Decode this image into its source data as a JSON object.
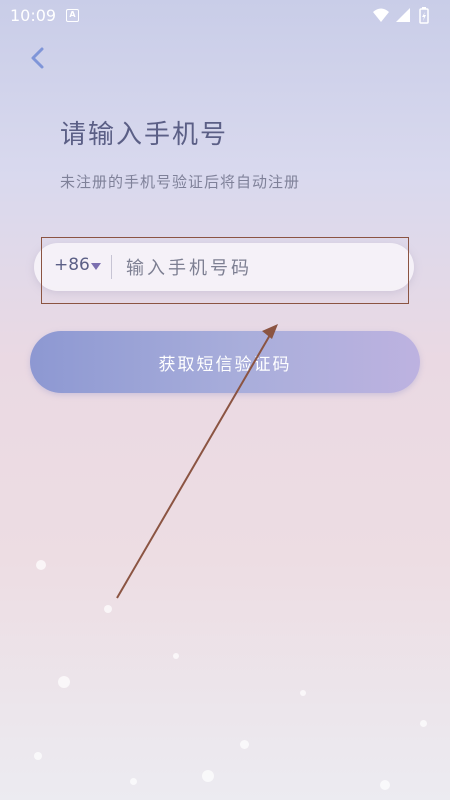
{
  "status_bar": {
    "time": "10:09",
    "app_notification_letter": "A",
    "icons": [
      "wifi-icon",
      "signal-icon",
      "battery-icon"
    ]
  },
  "navigation": {
    "back_icon": "chevron-left-icon"
  },
  "header": {
    "title": "请输入手机号",
    "subtitle": "未注册的手机号验证后将自动注册"
  },
  "phone_form": {
    "country_code": "+86",
    "country_dropdown_icon": "triangle-down-icon",
    "phone_value": "",
    "phone_placeholder": "输入手机号码"
  },
  "actions": {
    "get_code_label": "获取短信验证码"
  },
  "colors": {
    "title": "#5b5f86",
    "subtitle": "#7f8199",
    "button_start": "#8d98d2",
    "button_end": "#bdb2e0",
    "annotation": "#8b5442",
    "back_icon": "#7f95d8"
  }
}
